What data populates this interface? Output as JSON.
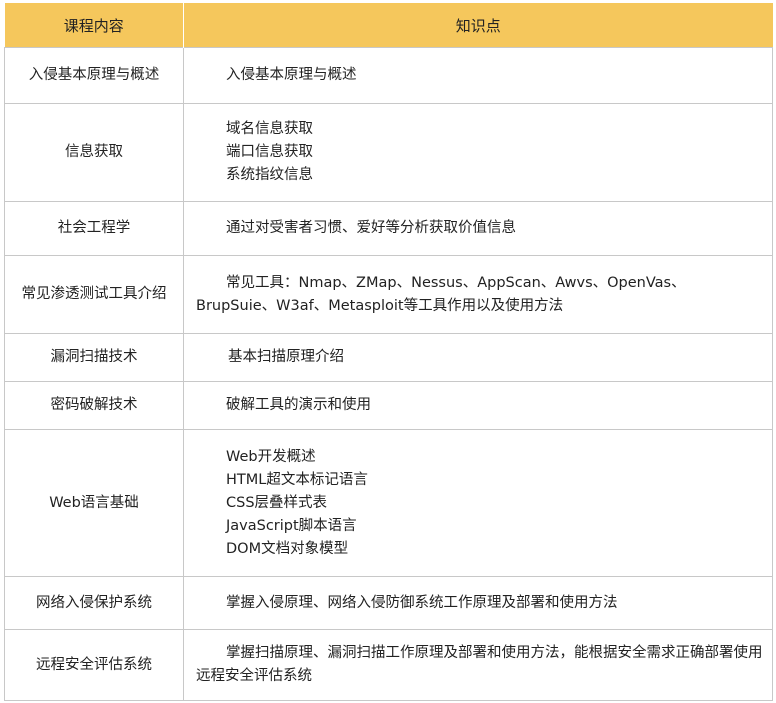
{
  "header": {
    "col1": "课程内容",
    "col2": "知识点"
  },
  "rows": [
    {
      "course": "入侵基本原理与概述",
      "points": [
        "入侵基本原理与概述"
      ]
    },
    {
      "course": "信息获取",
      "points": [
        "域名信息获取",
        "端口信息获取",
        "系统指纹信息"
      ]
    },
    {
      "course": "社会工程学",
      "points": [
        "通过对受害者习惯、爱好等分析获取价值信息"
      ]
    },
    {
      "course": "常见渗透测试工具介绍",
      "points": [
        "常见工具：Nmap、ZMap、Nessus、AppScan、Awvs、OpenVas、BrupSuie、W3af、Metasploit等工具作用以及使用方法"
      ]
    },
    {
      "course": "漏洞扫描技术",
      "points": [
        "基本扫描原理介绍"
      ]
    },
    {
      "course": "密码破解技术",
      "points": [
        "破解工具的演示和使用"
      ]
    },
    {
      "course": "Web语言基础",
      "points": [
        "Web开发概述",
        "HTML超文本标记语言",
        "CSS层叠样式表",
        "JavaScript脚本语言",
        "DOM文档对象模型"
      ]
    },
    {
      "course": "网络入侵保护系统",
      "points": [
        "掌握入侵原理、网络入侵防御系统工作原理及部署和使用方法"
      ]
    },
    {
      "course": "远程安全评估系统",
      "points": [
        "掌握扫描原理、漏洞扫描工作原理及部署和使用方法，能根据安全需求正确部署使用远程安全评估系统"
      ]
    }
  ]
}
